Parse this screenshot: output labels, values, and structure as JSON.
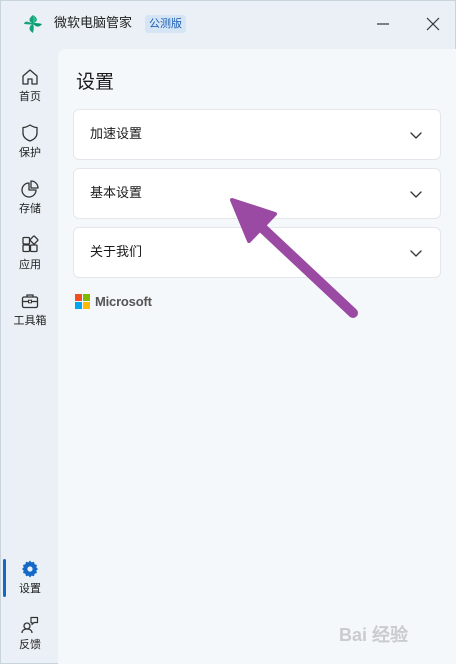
{
  "titlebar": {
    "app_title": "微软电脑管家",
    "badge": "公测版"
  },
  "sidebar": {
    "items": [
      {
        "label": "首页",
        "icon": "home-icon"
      },
      {
        "label": "保护",
        "icon": "shield-icon"
      },
      {
        "label": "存储",
        "icon": "pie-chart-icon"
      },
      {
        "label": "应用",
        "icon": "apps-icon"
      },
      {
        "label": "工具箱",
        "icon": "toolbox-icon"
      }
    ],
    "bottom_items": [
      {
        "label": "设置",
        "icon": "gear-icon",
        "active": true
      },
      {
        "label": "反馈",
        "icon": "feedback-icon"
      }
    ]
  },
  "main": {
    "title": "设置",
    "sections": [
      {
        "label": "加速设置"
      },
      {
        "label": "基本设置"
      },
      {
        "label": "关于我们"
      }
    ],
    "brand": "Microsoft"
  },
  "colors": {
    "accent": "#1668c7",
    "annotation_arrow": "#9b4aa3",
    "ms_red": "#f25022",
    "ms_green": "#7fba00",
    "ms_blue": "#00a4ef",
    "ms_yellow": "#ffb900"
  }
}
